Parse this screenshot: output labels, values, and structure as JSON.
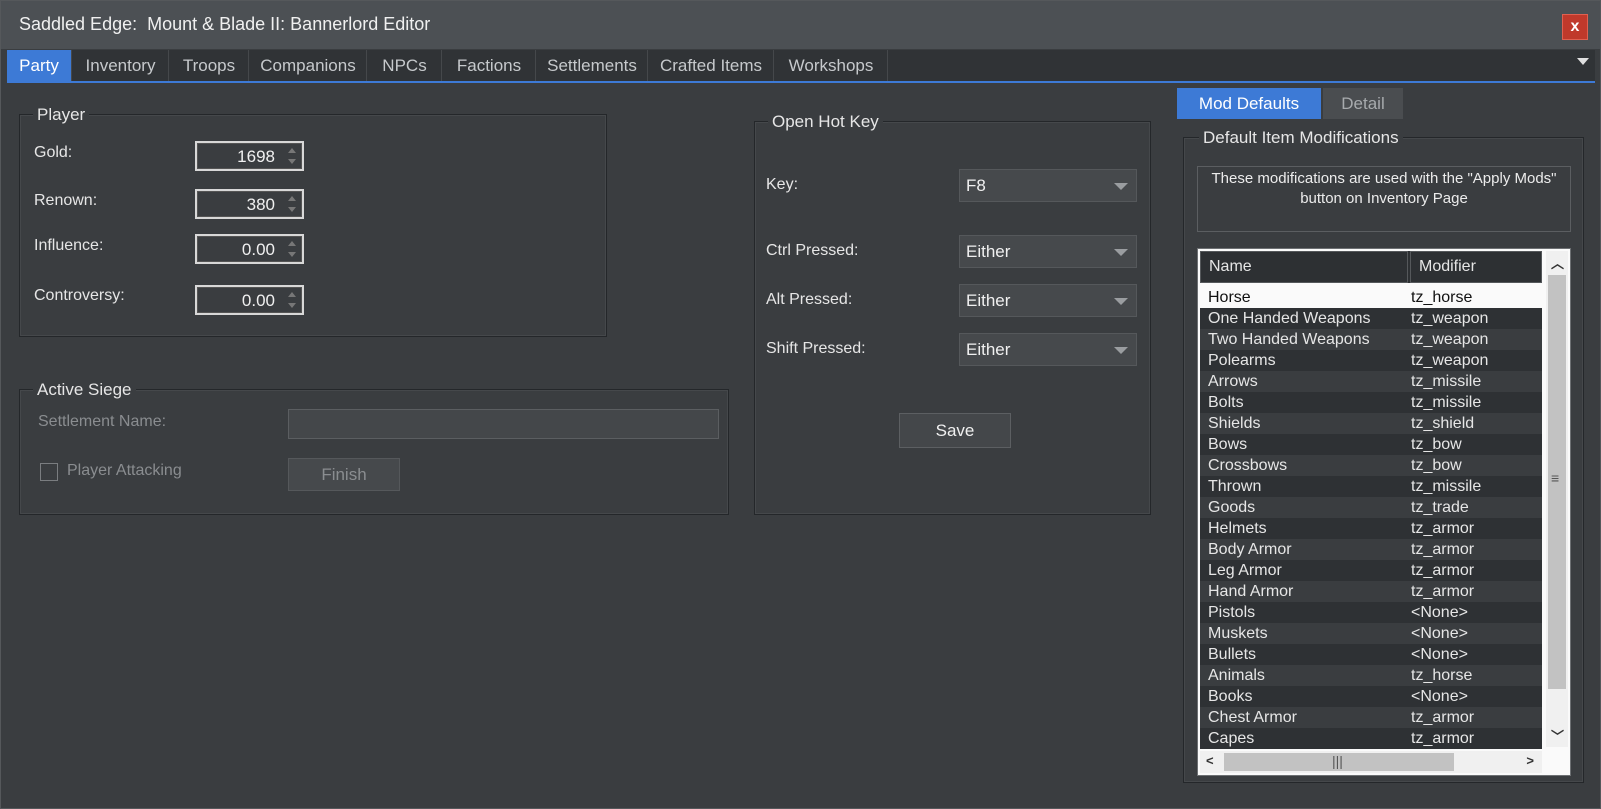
{
  "window": {
    "title": "Saddled Edge:  Mount & Blade II: Bannerlord Editor",
    "close_label": "x"
  },
  "tabs": [
    {
      "label": "Party",
      "active": true
    },
    {
      "label": "Inventory"
    },
    {
      "label": "Troops"
    },
    {
      "label": "Companions"
    },
    {
      "label": "NPCs"
    },
    {
      "label": "Factions"
    },
    {
      "label": "Settlements"
    },
    {
      "label": "Crafted Items"
    },
    {
      "label": "Workshops"
    }
  ],
  "player": {
    "title": "Player",
    "gold_label": "Gold:",
    "gold": "1698",
    "renown_label": "Renown:",
    "renown": "380",
    "influence_label": "Influence:",
    "influence": "0.00",
    "controversy_label": "Controversy:",
    "controversy": "0.00"
  },
  "siege": {
    "title": "Active Siege",
    "settlement_label": "Settlement Name:",
    "settlement_value": "",
    "player_attacking_label": "Player Attacking",
    "finish_label": "Finish"
  },
  "hotkey": {
    "title": "Open Hot Key",
    "key_label": "Key:",
    "key_value": "F8",
    "ctrl_label": "Ctrl Pressed:",
    "ctrl_value": "Either",
    "alt_label": "Alt Pressed:",
    "alt_value": "Either",
    "shift_label": "Shift Pressed:",
    "shift_value": "Either",
    "save_label": "Save"
  },
  "right_tabs": [
    {
      "label": "Mod Defaults",
      "active": true
    },
    {
      "label": "Detail"
    }
  ],
  "mods": {
    "title": "Default Item Modifications",
    "info": "These modifications are used with the \"Apply Mods\" button on Inventory Page",
    "columns": [
      "Name",
      "Modifier"
    ],
    "rows": [
      {
        "name": "Horse",
        "modifier": "tz_horse"
      },
      {
        "name": "One Handed Weapons",
        "modifier": "tz_weapon"
      },
      {
        "name": "Two Handed Weapons",
        "modifier": "tz_weapon"
      },
      {
        "name": "Polearms",
        "modifier": "tz_weapon"
      },
      {
        "name": "Arrows",
        "modifier": "tz_missile"
      },
      {
        "name": "Bolts",
        "modifier": "tz_missile"
      },
      {
        "name": "Shields",
        "modifier": "tz_shield"
      },
      {
        "name": "Bows",
        "modifier": "tz_bow"
      },
      {
        "name": "Crossbows",
        "modifier": "tz_bow"
      },
      {
        "name": "Thrown",
        "modifier": "tz_missile"
      },
      {
        "name": "Goods",
        "modifier": "tz_trade"
      },
      {
        "name": "Helmets",
        "modifier": "tz_armor"
      },
      {
        "name": "Body Armor",
        "modifier": "tz_armor"
      },
      {
        "name": "Leg Armor",
        "modifier": "tz_armor"
      },
      {
        "name": "Hand Armor",
        "modifier": "tz_armor"
      },
      {
        "name": "Pistols",
        "modifier": "<None>"
      },
      {
        "name": "Muskets",
        "modifier": "<None>"
      },
      {
        "name": "Bullets",
        "modifier": "<None>"
      },
      {
        "name": "Animals",
        "modifier": "tz_horse"
      },
      {
        "name": "Books",
        "modifier": "<None>"
      },
      {
        "name": "Chest Armor",
        "modifier": "tz_armor"
      },
      {
        "name": "Capes",
        "modifier": "tz_armor"
      }
    ],
    "selected_row": 0
  },
  "icons": {
    "close": "close-icon",
    "dropdown": "chevron-down-icon",
    "scroll_up": "chevron-up-icon",
    "scroll_down": "chevron-down-icon",
    "scroll_left": "chevron-left-icon",
    "scroll_right": "chevron-right-icon"
  },
  "colors": {
    "accent": "#3d7ad6",
    "close": "#c0392b",
    "background": "#3a3d40"
  }
}
